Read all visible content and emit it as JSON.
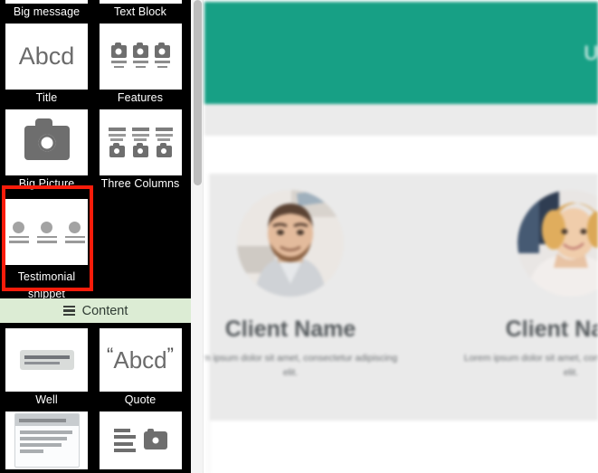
{
  "sidebar": {
    "snippets": [
      {
        "label": "Big message",
        "art": "cut-top",
        "selected": false
      },
      {
        "label": "Text Block",
        "art": "cut-top",
        "selected": false
      },
      {
        "label": "Title",
        "art": "title-abcd",
        "selected": false,
        "art_text": "Abcd"
      },
      {
        "label": "Features",
        "art": "features-cams",
        "selected": false
      },
      {
        "label": "Big Picture",
        "art": "big-camera",
        "selected": false
      },
      {
        "label": "Three Columns",
        "art": "three-columns",
        "selected": false
      },
      {
        "label": "Testimonial snippet",
        "art": "testimonial",
        "selected": true
      }
    ],
    "section_header": {
      "label": "Content",
      "icon": "hamburger-icon",
      "background": "#dcecd4"
    },
    "content_snippets": [
      {
        "label": "Well",
        "art": "well-box"
      },
      {
        "label": "Quote",
        "art": "quote-abcd",
        "art_text": "Abcd",
        "quote_open": "“",
        "quote_close": "”"
      },
      {
        "label": "",
        "art": "panel-card"
      },
      {
        "label": "",
        "art": "text-image"
      }
    ],
    "selection_color": "#f91c0a",
    "background": "#000000"
  },
  "scrollbar": {
    "thumb_color": "#bdbdbd",
    "track_color": "#f4f4f4"
  },
  "preview": {
    "hero": {
      "title": "Unlimited",
      "background": "#17a085",
      "text_color": "#ffffff"
    },
    "testimonials": {
      "background": "#eaeaea",
      "cards": [
        {
          "name": "Client Name",
          "text": "Lorem ipsum dolor sit amet, consectetur adipiscing elit.",
          "avatar": "photo-man"
        },
        {
          "name": "Client Name",
          "text": "Lorem ipsum dolor sit amet, consectetur adipiscing elit.",
          "avatar": "photo-woman"
        }
      ]
    }
  }
}
